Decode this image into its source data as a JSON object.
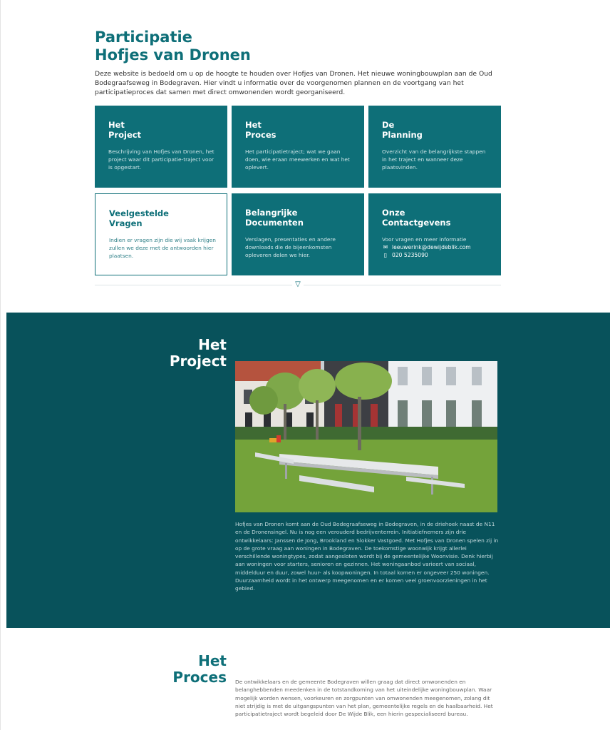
{
  "intro": {
    "title_line1": "Participatie",
    "title_line2": "Hofjes van Dronen",
    "text": "Deze website is bedoeld om u op de hoogte te houden over Hofjes van Dronen. Het nieuwe woningbouwplan aan de Oud Bodegraafseweg in Bodegraven. Hier vindt u informatie over de voorgenomen plannen en de voortgang van het participatieproces dat samen met direct omwonenden wordt georganiseerd."
  },
  "tiles": [
    {
      "line1": "Het",
      "line2": "Project",
      "desc": "Beschrijving van Hofjes van Dronen, het project waar dit participatie-traject voor is opgestart."
    },
    {
      "line1": "Het",
      "line2": "Proces",
      "desc": "Het participatietraject; wat we gaan doen, wie eraan meewerken en wat het oplevert."
    },
    {
      "line1": "De",
      "line2": "Planning",
      "desc": "Overzicht van de belangrijkste stappen in het traject en wanneer deze plaatsvinden."
    },
    {
      "line1": "Veelgestelde",
      "line2": "Vragen",
      "desc": "Indien er vragen zijn die wij vaak krijgen zullen we deze met de antwoorden hier plaatsen."
    },
    {
      "line1": "Belangrijke",
      "line2": "Documenten",
      "desc": "Verslagen, presentaties en andere downloads die de bijeenkomsten opleveren delen we hier."
    },
    {
      "line1": "Onze",
      "line2": "Contactgevens",
      "desc": "Voor vragen en meer informatie",
      "email": "leeuwerink@dewijdeblik.com",
      "phone": "020 5235090",
      "email_icon": "mail-icon",
      "phone_icon": "phone-icon"
    }
  ],
  "divider": {
    "icon": "chevron-down-icon",
    "glyph": "▽"
  },
  "project": {
    "title_line1": "Het",
    "title_line2": "Project",
    "text": "Hofjes van Dronen komt aan de Oud Bodegraafseweg in Bodegraven, in de driehoek naast de N11 en de Dronensingel. Nu is nog een verouderd bedrijventerrein. Initiatiefnemers zijn drie ontwikkelaars: Janssen de Jong, Brookland en Slokker Vastgoed. Met Hofjes van Dronen spelen zij in op de grote vraag aan woningen in Bodegraven. De toekomstige woonwijk krijgt allerlei verschillende woningtypes, zodat aangesloten wordt bij de gemeentelijke Woonvisie. Denk hierbij aan woningen voor starters, senioren en gezinnen. Het woningaanbod varieert van sociaal, middelduur en duur, zowel huur- als koopwoningen. In totaal komen er ongeveer 250 woningen. Duurzaamheid wordt in het ontwerp meegenomen en er komen veel groenvoorzieningen in het gebied."
  },
  "proces": {
    "title_line1": "Het",
    "title_line2": "Proces",
    "text": "De ontwikkelaars en de gemeente Bodegraven willen graag dat direct omwonenden en belanghebbenden meedenken in de totstandkoming van het uiteindelijke woningbouwplan. Waar mogelijk worden wensen, voorkeuren en zorgpunten van omwonenden meegenomen, zolang dit niet strijdig is met de uitgangspunten van het plan, gemeentelijke regels en de haalbaarheid. Het participatietraject wordt begeleid door De Wijde Blik, een hierin gespecialiseerd bureau."
  },
  "colors": {
    "accent": "#0e6f78",
    "dark_band": "#08525b"
  }
}
